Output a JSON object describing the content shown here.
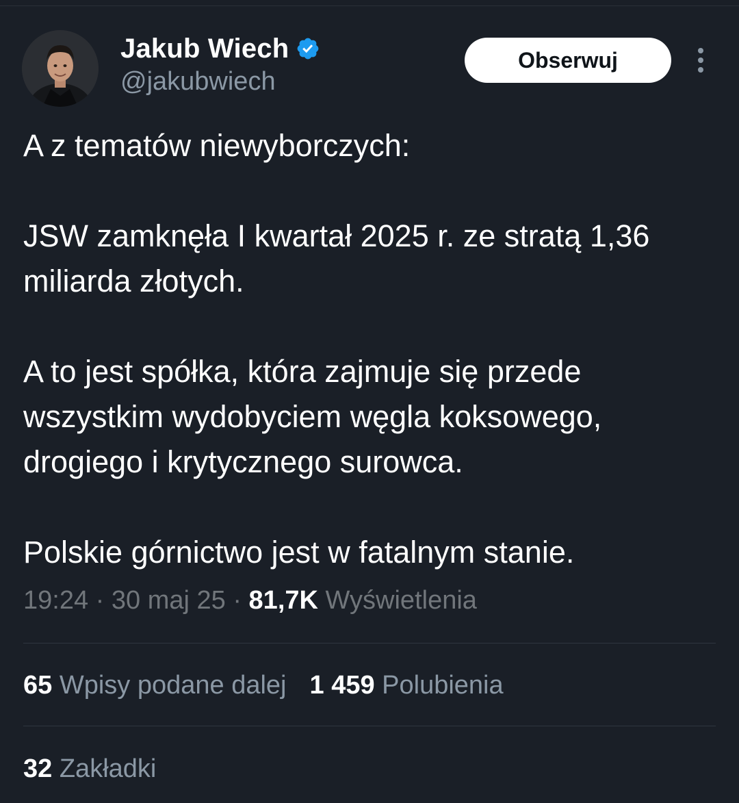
{
  "author": {
    "name": "Jakub Wiech",
    "handle": "@jakubwiech",
    "verified_icon": "verified-badge-icon",
    "verified_color": "#1d9bf0"
  },
  "actions": {
    "follow_label": "Obserwuj",
    "more_icon": "more-vertical-icon"
  },
  "tweet": {
    "paragraphs": [
      "A z tematów niewyborczych:",
      "JSW zamknęła I kwartał 2025 r. ze stratą 1,36 miliarda złotych.",
      "A to jest spółka, która zajmuje się przede wszystkim wydobyciem węgla koksowego, drogiego i krytycznego surowca.",
      "Polskie górnictwo jest w fatalnym stanie."
    ]
  },
  "meta": {
    "time": "19:24",
    "separator": "·",
    "date": "30 maj 25",
    "views_count": "81,7K",
    "views_label": "Wyświetlenia"
  },
  "stats": {
    "reposts_count": "65",
    "reposts_label": "Wpisy podane dalej",
    "likes_count": "1 459",
    "likes_label": "Polubienia",
    "bookmarks_count": "32",
    "bookmarks_label": "Zakładki"
  },
  "colors": {
    "background": "#1a1f27",
    "text": "#ffffff",
    "muted": "#71767b"
  }
}
